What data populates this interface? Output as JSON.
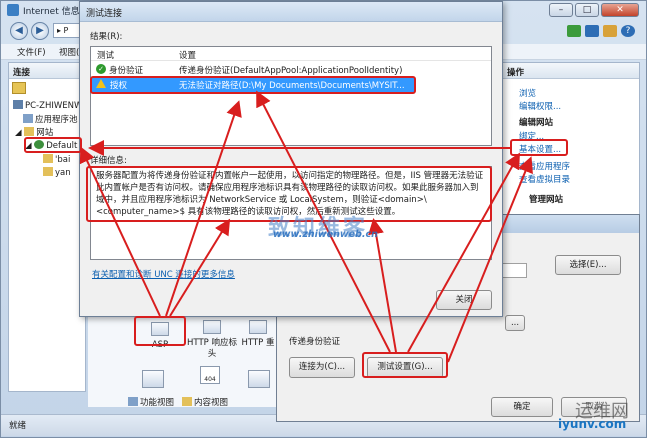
{
  "main_window": {
    "title": "Internet 信息服",
    "address_fragment": "▸ P",
    "menu": [
      "文件(F)",
      "视图("
    ],
    "connections_header": "连接",
    "tree": [
      {
        "label": "PC-ZHIWENW"
      },
      {
        "label": "应用程序池"
      },
      {
        "label": "网站"
      },
      {
        "label": "Default"
      },
      {
        "label": "'bai"
      },
      {
        "label": "yan"
      }
    ],
    "actions_header": "操作",
    "actions": [
      "浏览",
      "编辑权限...",
      "编辑网站",
      "绑定...",
      "基本设置...",
      "查看应用程序",
      "查看虚拟目录",
      "管理网站"
    ],
    "features": [
      {
        "label": "ASP"
      },
      {
        "label": "HTTP 响应标头"
      },
      {
        "label": "HTTP 重"
      }
    ],
    "feature_icon_404": "404",
    "bottom_tabs": [
      "功能视图",
      "内容视图"
    ],
    "status": "就绪"
  },
  "edit_site_dialog": {
    "select_button": "选择(E)...",
    "more_button": "...",
    "section_label": "传递身份验证",
    "connect_as_button": "连接为(C)...",
    "test_settings_button": "测试设置(G)...",
    "ok_button": "确定",
    "cancel_button": "取消"
  },
  "test_connection_dialog": {
    "title": "测试连接",
    "results_label": "结果(R):",
    "columns": [
      "测试",
      "设置"
    ],
    "rows": [
      {
        "test": "身份验证",
        "setting": "传递身份验证(DefaultAppPool:ApplicationPoolIdentity)",
        "status": "ok"
      },
      {
        "test": "授权",
        "setting": "无法验证对路径(D:\\My Documents\\Documents\\MYSIT...",
        "status": "warn"
      }
    ],
    "details_label": "详细信息:",
    "details_text": "服务器配置为将传递身份验证和内置帐户一起使用，以访问指定的物理路径。但是，IIS 管理器无法验证此内置帐户是否有访问权。请确保应用程序池标识具有该物理路径的读取访问权。如果此服务器加入到域中，并且应用程序池标识为 NetworkService 或 LocalSystem，则验证<domain>\\<computer_name>$ 具有该物理路径的读取访问权，然后重新测试这些设置。",
    "help_link": "有关配置和诊断 UNC 连接的更多信息",
    "close_button": "关闭"
  },
  "watermarks": {
    "site_brand": "致知维客",
    "site_url": "www.zhiwenweb.cn",
    "corner_brand": "运维网",
    "corner_url": "iyunv.com"
  },
  "colors": {
    "accent_red": "#d81e1e",
    "selection_blue": "#3399ff",
    "link_blue": "#0b5fb0"
  }
}
